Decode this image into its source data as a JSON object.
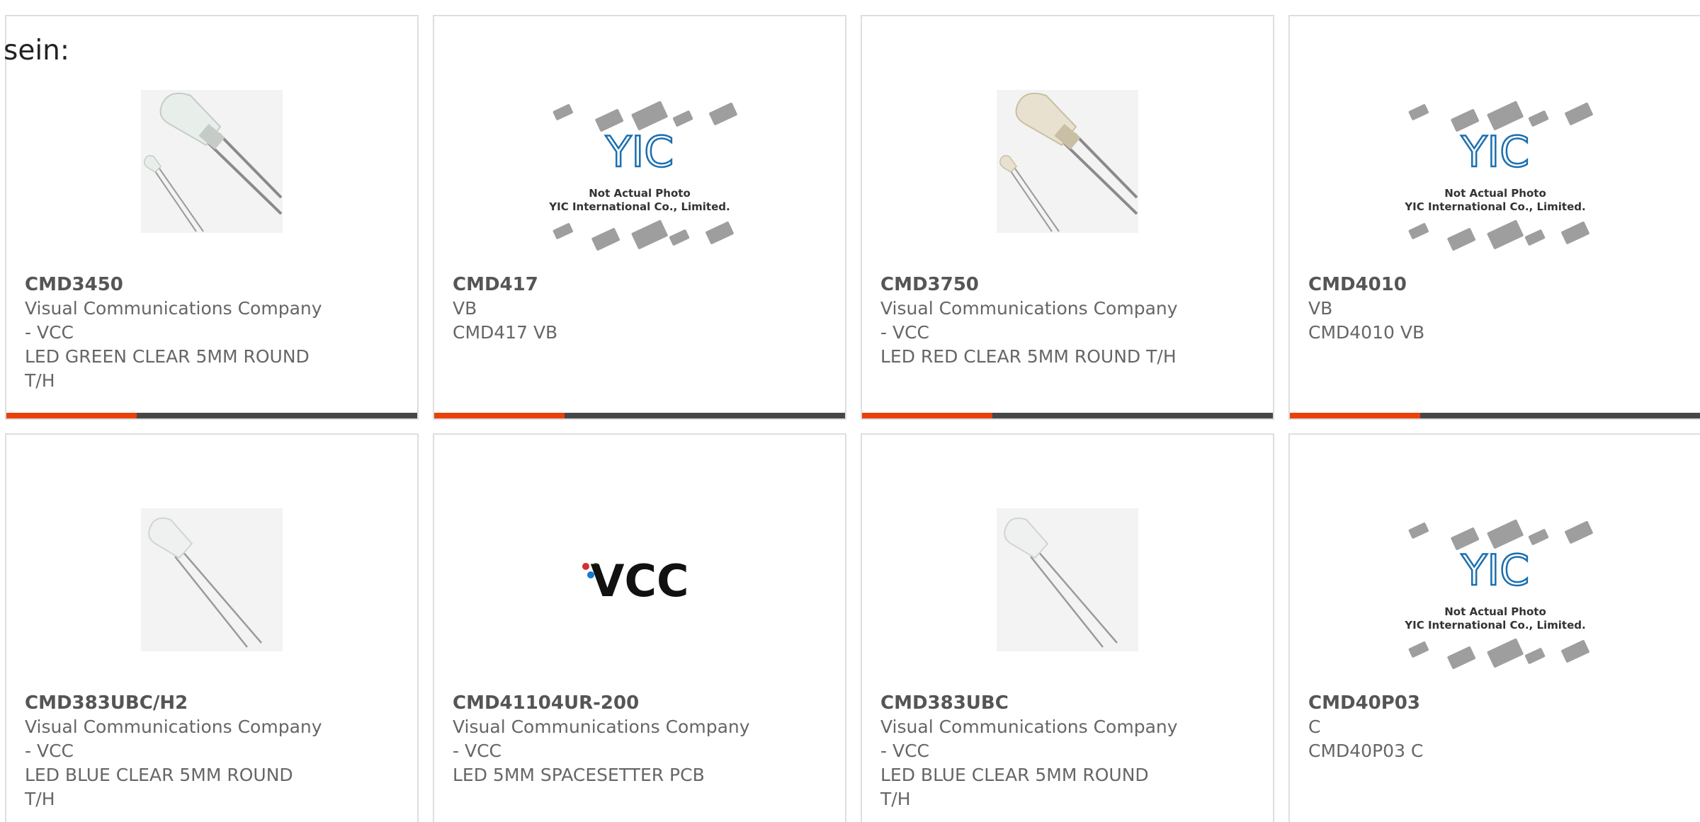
{
  "intro_text": "sein:",
  "products": [
    {
      "part_number": "CMD3450",
      "manufacturer": "Visual Communications Company - VCC",
      "description": "LED GREEN CLEAR 5MM ROUND T/H",
      "image": "led-photo-large",
      "has_bar": true
    },
    {
      "part_number": "CMD417",
      "manufacturer": "VB",
      "description": "CMD417 VB",
      "image": "yic-placeholder",
      "has_bar": true
    },
    {
      "part_number": "CMD3750",
      "manufacturer": "Visual Communications Company - VCC",
      "description": "LED RED CLEAR 5MM ROUND T/H",
      "image": "led-photo-large-warm",
      "has_bar": true
    },
    {
      "part_number": "CMD4010",
      "manufacturer": "VB",
      "description": "CMD4010 VB",
      "image": "yic-placeholder",
      "has_bar": true
    },
    {
      "part_number": "CMD383UBC/H2",
      "manufacturer": "Visual Communications Company - VCC",
      "description": "LED BLUE CLEAR 5MM ROUND T/H",
      "image": "led-photo-small",
      "has_bar": false
    },
    {
      "part_number": "CMD41104UR-200",
      "manufacturer": "Visual Communications Company - VCC",
      "description": "LED 5MM SPACESETTER PCB",
      "image": "vcc-logo",
      "has_bar": false
    },
    {
      "part_number": "CMD383UBC",
      "manufacturer": "Visual Communications Company - VCC",
      "description": "LED BLUE CLEAR 5MM ROUND T/H",
      "image": "led-photo-small",
      "has_bar": false
    },
    {
      "part_number": "CMD40P03",
      "manufacturer": "C",
      "description": "CMD40P03 C",
      "image": "yic-placeholder",
      "has_bar": false
    }
  ],
  "placeholder_caption_line1": "Not Actual Photo",
  "placeholder_caption_line2": "YIC International Co., Limited.",
  "placeholder_logo_text": "YIC",
  "vcc_logo_text": "VCC",
  "colors": {
    "accent": "#e8410a",
    "bar": "#474747",
    "yic_blue": "#1a6fb0"
  }
}
